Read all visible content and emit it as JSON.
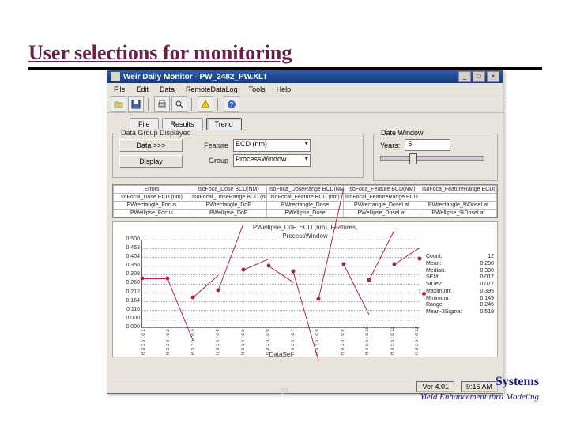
{
  "slide": {
    "title": "User selections for monitoring",
    "number": "27",
    "company": "Systems",
    "tagline": "Yield Enhancement thru Modeling"
  },
  "window": {
    "title": "Weir Daily Monitor - PW_2482_PW.XLT",
    "menus": [
      "File",
      "Edit",
      "Data",
      "RemoteDataLog",
      "Tools",
      "Help"
    ],
    "tb_icons": [
      "folder-open-icon",
      "save-icon",
      "print-icon",
      "preview-icon",
      "alert-icon",
      "help-icon"
    ]
  },
  "tabs": {
    "file": "File",
    "results": "Results",
    "trend": "Trend"
  },
  "controls": {
    "data_group_legend": "Data Group Displayed",
    "date_window_legend": "Date Window",
    "data_btn": "Data >>>",
    "display_btn": "Display",
    "feature_lbl": "Feature",
    "feature_val": "ECD (nm)",
    "group_lbl": "Group",
    "group_val": "ProcessWindow",
    "years_lbl": "Years:",
    "years_val": "5"
  },
  "table": {
    "rows": [
      [
        "Errors",
        "IsoFoca_Dose BCD(NM)",
        "IsoFoca_DoseRange BCD(NM)",
        "IsoFoca_Feature BCD(NM)",
        "IsoFoca_FeatureRange ECD(NM)"
      ],
      [
        "soFocal_Dose ECD (nm)",
        "IsoFocal_DoseRange BCD (nm)",
        "IsoFocal_Feature BCD (nm)",
        "IsoFocal_FeatureRange ECD (nm)",
        ""
      ],
      [
        "PWrectangle_Focus",
        "PWrectangle_DoF",
        "PWrectangle_Dose",
        "PWrectangle_DoseLat",
        "PWrectangle_%DoseLat"
      ],
      [
        "PWellipse_Focus",
        "PWellipse_DoF",
        "PWellipse_Dose",
        "PWellipse_DoseLat",
        "PWellipse_%DoseLat"
      ]
    ]
  },
  "chart_data": {
    "type": "line",
    "title_line1": "PWellipse_DoF, ECD (nm), Features,",
    "title_line2": "ProcessWindow",
    "series_name": "1",
    "yticks": [
      "0.500",
      "0.453",
      "0.404",
      "0.356",
      "0.308",
      "0.260",
      "0.212",
      "0.164",
      "0.116",
      "0.000",
      "0.000"
    ],
    "ylim": [
      0,
      0.5
    ],
    "xlabel": "DataSet",
    "xticks": [
      "R e c o r d 1",
      "R e c o r d 2",
      "R e c o r d 3",
      "R e c o r d 4",
      "R e c o r d 5",
      "R e c o r d 6",
      "R e c o r d 7",
      "R e c o r d 8",
      "R e c o r d 9",
      "R e c o r d 10",
      "R e c o r d 11",
      "R e c o r d 12"
    ],
    "values": [
      0.28,
      0.28,
      0.17,
      0.21,
      0.33,
      0.35,
      0.32,
      0.16,
      0.36,
      0.27,
      0.36,
      0.39
    ],
    "stats": {
      "Count": "12",
      "Mean": "0.290",
      "Median": "0.300",
      "SEM": "0.017",
      "StDev": "0.077",
      "Maximum": "0.395",
      "Minimum": "0.149",
      "Range": "0.245",
      "Mean-3Sigma": "0.519"
    }
  },
  "status": {
    "ver": "Ver 4.01",
    "time": "9:16 AM"
  }
}
